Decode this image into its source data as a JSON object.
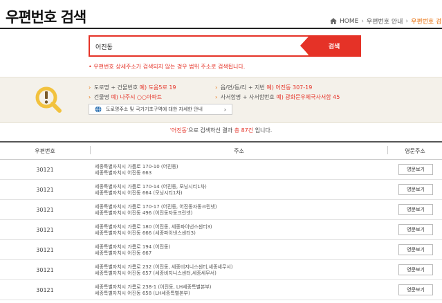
{
  "header": {
    "title": "우편번호 검색",
    "breadcrumb": {
      "home": "HOME",
      "parent": "우편번호 안내",
      "current": "우편번호 검색"
    }
  },
  "search": {
    "value": "어진동",
    "placeholder": "",
    "button_label": "검색",
    "notice": "• 우편번호 상세주소가 검색되지 않는 경우 범위 주소로 검색됩니다."
  },
  "tips": {
    "road_label": "도로명 + 건물번호",
    "road_example": "예) 도움5로 19",
    "building_label": "건물명",
    "building_example": "예) 나주시 ○○아파트",
    "jibun_label": "읍/면/동/리 + 지번",
    "jibun_example": "예) 어진동 307-19",
    "pobox_label": "사서함명 + 사서함번호",
    "pobox_example": "예) 광화문우체국사서함 45",
    "guide_link": "도로명주소 및 국가기초구역에 대한 자세한 안내"
  },
  "result": {
    "keyword": "'어진동'",
    "prefix": "으로 검색하신 결과",
    "count": "총 87건",
    "suffix": "입니다."
  },
  "table": {
    "headers": {
      "zip": "우편번호",
      "address": "주소",
      "english": "영문주소"
    },
    "button_label": "영문보기",
    "rows": [
      {
        "zip": "30121",
        "road": "세종특별자치시 가름로 170-10 (어진동)",
        "jibun": "세종특별자치시 어진동 663"
      },
      {
        "zip": "30121",
        "road": "세종특별자치시 가름로 170-14 (어진동, 모닝시티1차)",
        "jibun": "세종특별자치시 어진동 664 (모닝시티1차)"
      },
      {
        "zip": "30121",
        "road": "세종특별자치시 가름로 170-17 (어진동, 어진동자동크린넷)",
        "jibun": "세종특별자치시 어진동 496 (어진동자동크린넷)"
      },
      {
        "zip": "30121",
        "road": "세종특별자치시 가름로 180 (어진동, 세종파이낸스센터3)",
        "jibun": "세종특별자치시 어진동 666 (세종파이낸스센터3)"
      },
      {
        "zip": "30121",
        "road": "세종특별자치시 가름로 194 (어진동)",
        "jibun": "세종특별자치시 어진동 667"
      },
      {
        "zip": "30121",
        "road": "세종특별자치시 가름로 232 (어진동, 세종비지니스센터,세종세무서)",
        "jibun": "세종특별자치시 어진동 657 (세종비지니스센터,세종세무서)"
      },
      {
        "zip": "30121",
        "road": "세종특별자치시 가름로 238-1 (어진동, LH세종특별본부)",
        "jibun": "세종특별자치시 어진동 658 (LH세종특별본부)"
      }
    ]
  },
  "colors": {
    "accent": "#e53227",
    "breadcrumb_current": "#e86a00",
    "tips_bg": "#f4f1ea",
    "icon_yellow": "#f2c23e"
  },
  "icons": {
    "home": "home-icon",
    "tips": "exclamation-magnifier-icon",
    "guide": "globe-icon",
    "search_deco": "chevrons-icon"
  }
}
